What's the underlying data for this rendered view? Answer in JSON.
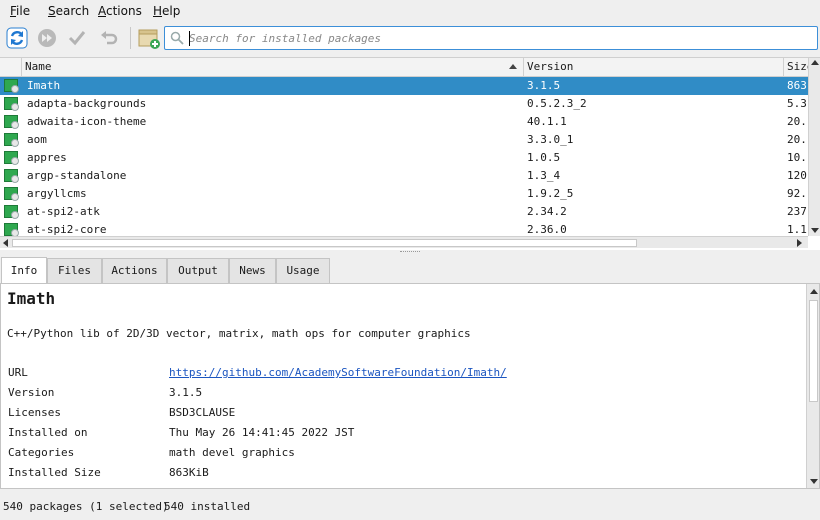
{
  "menu": [
    {
      "label_u": "F",
      "label_rest": "ile"
    },
    {
      "label_u": "S",
      "label_rest": "earch"
    },
    {
      "label_u": "A",
      "label_rest": "ctions"
    },
    {
      "label_u": "H",
      "label_rest": "elp"
    }
  ],
  "toolbar": {
    "buttons": [
      "refresh-icon",
      "fast-forward-icon",
      "apply-check-icon",
      "undo-icon",
      "package-add-icon"
    ]
  },
  "search": {
    "placeholder": "Search for installed packages",
    "value": ""
  },
  "list": {
    "columns": {
      "name": "Name",
      "version": "Version",
      "size": "Size"
    },
    "rows": [
      {
        "name": "Imath",
        "version": "3.1.5",
        "size": "863"
      },
      {
        "name": "adapta-backgrounds",
        "version": "0.5.2.3_2",
        "size": "5.3"
      },
      {
        "name": "adwaita-icon-theme",
        "version": "40.1.1",
        "size": "20."
      },
      {
        "name": "aom",
        "version": "3.3.0_1",
        "size": "20."
      },
      {
        "name": "appres",
        "version": "1.0.5",
        "size": "10."
      },
      {
        "name": "argp-standalone",
        "version": "1.3_4",
        "size": "120"
      },
      {
        "name": "argyllcms",
        "version": "1.9.2_5",
        "size": "92."
      },
      {
        "name": "at-spi2-atk",
        "version": "2.34.2",
        "size": "237"
      },
      {
        "name": "at-spi2-core",
        "version": "2.36.0",
        "size": "1.1"
      }
    ],
    "selected_index": 0
  },
  "tabs": [
    "Info",
    "Files",
    "Actions",
    "Output",
    "News",
    "Usage"
  ],
  "info": {
    "title": "Imath",
    "description": "C++/Python lib of 2D/3D vector, matrix, math ops for computer graphics",
    "fields": [
      {
        "key": "URL",
        "value": "https://github.com/AcademySoftwareFoundation/Imath/"
      },
      {
        "key": "Version",
        "value": "3.1.5"
      },
      {
        "key": "Licenses",
        "value": "BSD3CLAUSE"
      },
      {
        "key": "Installed on",
        "value": "Thu May 26 14:41:45 2022 JST"
      },
      {
        "key": "Categories",
        "value": "math devel graphics"
      },
      {
        "key": "Installed Size",
        "value": "863KiB"
      }
    ]
  },
  "status": {
    "packages": "540 packages (1 selected)",
    "installed": "540 installed"
  },
  "colors": {
    "selection": "#308cc6",
    "link": "#1b55c0",
    "accent": "#3c8fd8"
  }
}
